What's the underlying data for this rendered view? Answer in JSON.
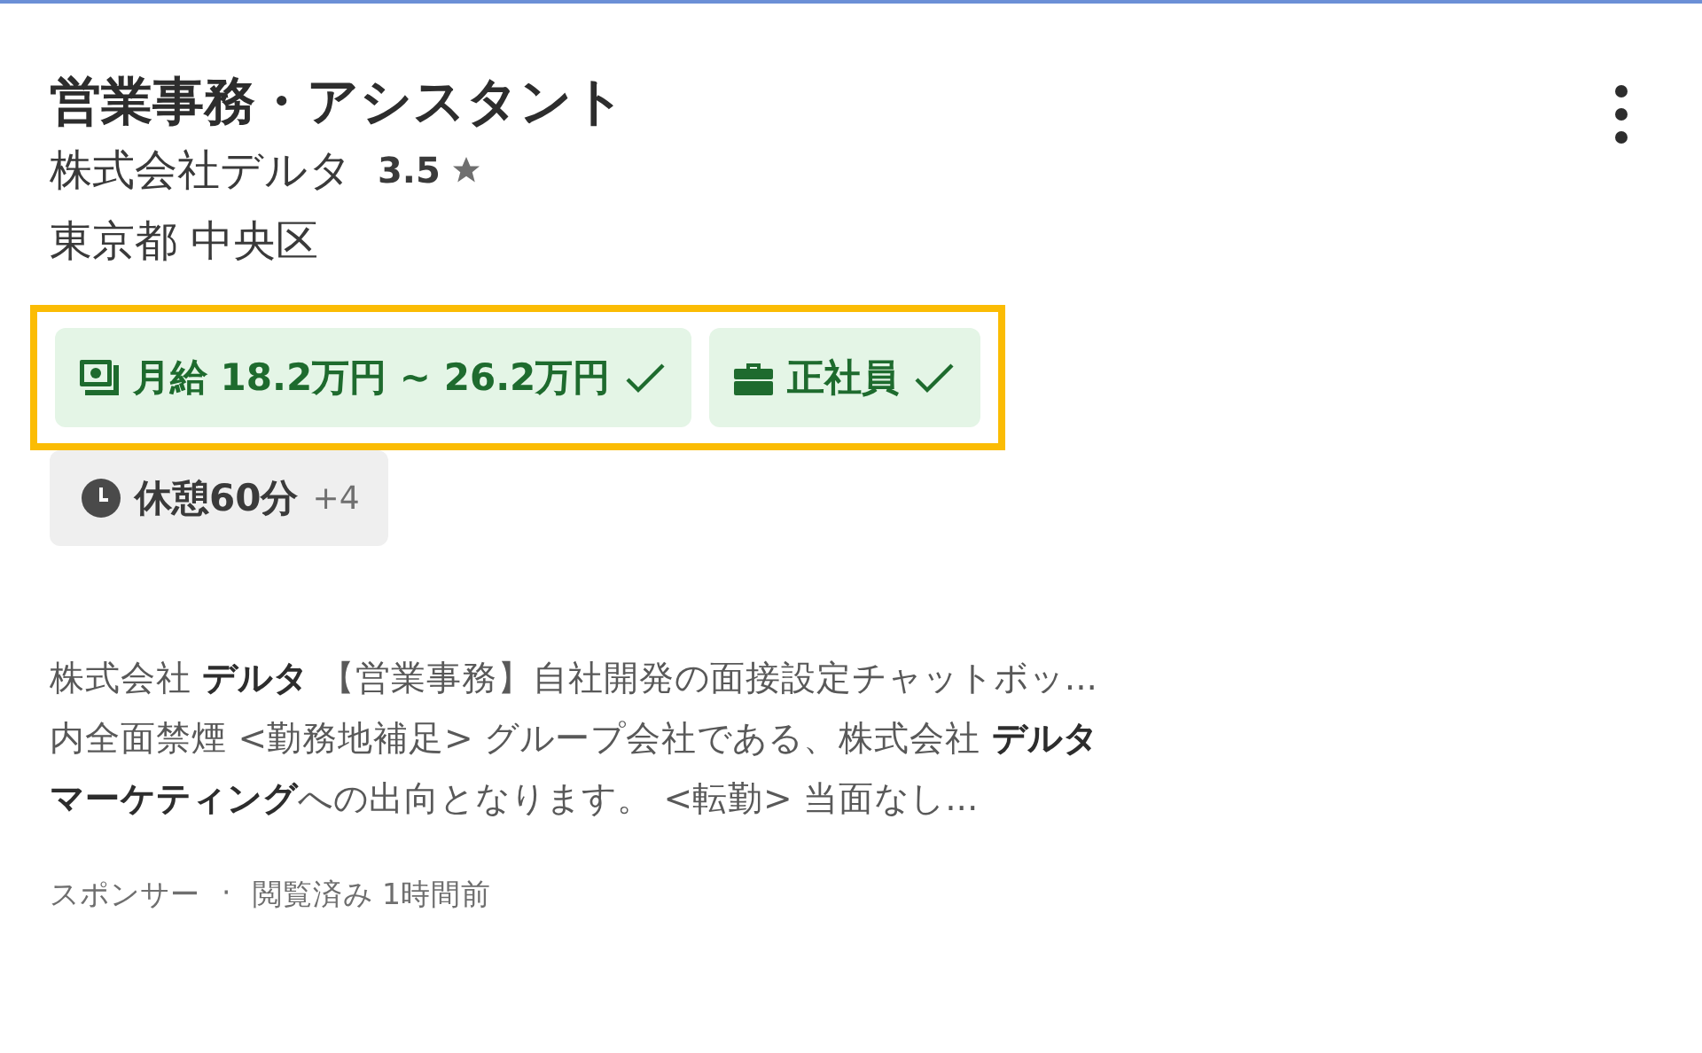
{
  "job": {
    "title": "営業事務・アシスタント",
    "company": "株式会社デルタ",
    "rating": "3.5",
    "location": "東京都 中央区"
  },
  "tags": {
    "highlighted": true,
    "items": [
      {
        "kind": "salary",
        "text": "月給 18.2万円 ~ 26.2万円",
        "verified": true
      },
      {
        "kind": "job-type",
        "text": "正社員",
        "verified": true
      }
    ]
  },
  "extra_tag": {
    "kind": "break",
    "text": "休憩60分",
    "more": "+4"
  },
  "snippet": [
    "株式会社 **デルタ** 【営業事務】自社開発の面接設定チャットボッ...",
    "内全面禁煙 <勤務地補足> グループ会社である、株式会社 **デルタ**",
    "**マーケティング**への出向となります。 <転勤> 当面なし..."
  ],
  "footer": {
    "sponsor": "スポンサー",
    "separator": "·",
    "viewed": "閲覧済み 1時間前"
  }
}
